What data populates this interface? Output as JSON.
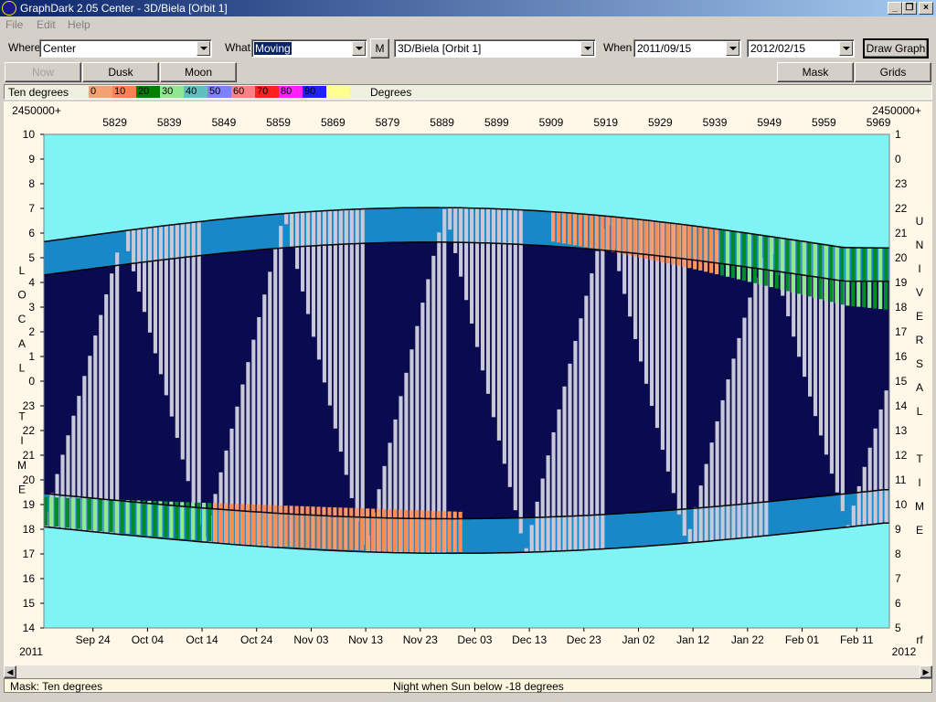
{
  "window": {
    "title": "GraphDark 2.05  Center  -  3D/Biela [Orbit 1]"
  },
  "menu": [
    "File",
    "Edit",
    "Help"
  ],
  "toolbar": {
    "where_label": "Where",
    "where_value": "Center",
    "what_label": "What",
    "what_value": "Moving",
    "m_button": "M",
    "object_value": "3D/Biela [Orbit 1]",
    "when_label": "When",
    "start_date": "2011/09/15",
    "end_date": "2012/02/15",
    "draw_button": "Draw Graph"
  },
  "buttons": {
    "now": "Now",
    "dusk": "Dusk",
    "moon": "Moon",
    "mask": "Mask",
    "grids": "Grids"
  },
  "legend": {
    "title": "Ten degrees",
    "unit": "Degrees",
    "items": [
      {
        "label": "0",
        "color": "#f4a070"
      },
      {
        "label": "10",
        "color": "#ff8050"
      },
      {
        "label": "20",
        "color": "#008000"
      },
      {
        "label": "30",
        "color": "#90e890"
      },
      {
        "label": "40",
        "color": "#60c0c0"
      },
      {
        "label": "50",
        "color": "#8080ff"
      },
      {
        "label": "60",
        "color": "#ff8080"
      },
      {
        "label": "70",
        "color": "#ff2020"
      },
      {
        "label": "80",
        "color": "#ff20ff"
      },
      {
        "label": "90",
        "color": "#2020ff"
      },
      {
        "label": "",
        "color": "#ffff90"
      }
    ]
  },
  "chart_data": {
    "type": "heatmap",
    "jd_prefix_left": "2450000+",
    "jd_prefix_right": "2450000+",
    "jd_ticks": [
      "5829",
      "5839",
      "5849",
      "5859",
      "5869",
      "5879",
      "5889",
      "5899",
      "5909",
      "5919",
      "5929",
      "5939",
      "5949",
      "5959",
      "5969"
    ],
    "local_time_ticks": [
      "10",
      "9",
      "8",
      "7",
      "6",
      "5",
      "4",
      "3",
      "2",
      "1",
      "0",
      "23",
      "22",
      "21",
      "20",
      "19",
      "18",
      "17",
      "16",
      "15",
      "14"
    ],
    "universal_time_ticks": [
      "1",
      "0",
      "23",
      "22",
      "21",
      "20",
      "19",
      "18",
      "17",
      "16",
      "15",
      "14",
      "13",
      "12",
      "11",
      "10",
      "9",
      "8",
      "7",
      "6",
      "5"
    ],
    "date_ticks": [
      "Sep 24",
      "Oct 04",
      "Oct 14",
      "Oct 24",
      "Nov 03",
      "Nov 13",
      "Nov 23",
      "Dec 03",
      "Dec 13",
      "Dec 23",
      "Jan 02",
      "Jan 12",
      "Jan 22",
      "Feb 01",
      "Feb 11"
    ],
    "year_left": "2011",
    "year_right": "2012",
    "right_corner": "rf",
    "left_axis_title": [
      "L",
      "O",
      "C",
      "A",
      "L",
      "",
      "T",
      "I",
      "M",
      "E"
    ],
    "right_axis_title": [
      "U",
      "N",
      "I",
      "V",
      "E",
      "R",
      "S",
      "A",
      "L",
      "",
      "T",
      "I",
      "M",
      "E"
    ],
    "colors": {
      "day": "#80f4f4",
      "night": "#0a0a50",
      "moon": "#c8c8d8",
      "twilight": "#1888c8",
      "outline": "#000000"
    }
  },
  "status": {
    "left": "Mask:  Ten degrees",
    "center": "Night when Sun below -18 degrees"
  }
}
